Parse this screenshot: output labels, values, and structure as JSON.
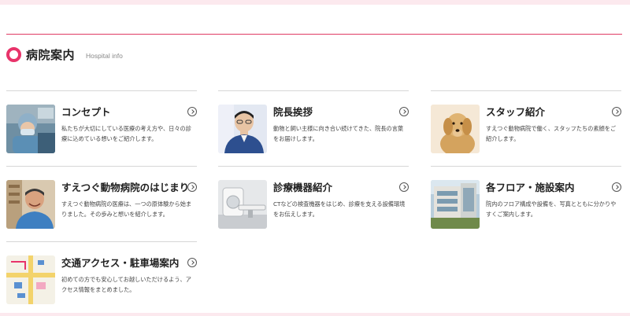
{
  "section": {
    "title": "病院案内",
    "subtitle": "Hospital info"
  },
  "cards": [
    {
      "title": "コンセプト",
      "desc": "私たちが大切にしている医療の考え方や、日々の診療に込めている想いをご紹介します。",
      "icon": "surgery-photo"
    },
    {
      "title": "院長挨拶",
      "desc": "動物と飼い主様に向き合い続けてきた、院長の言葉をお届けします。",
      "icon": "director-photo"
    },
    {
      "title": "スタッフ紹介",
      "desc": "すえつぐ動物病院で働く、スタッフたちの素顔をご紹介します。",
      "icon": "dog-photo"
    },
    {
      "title": "すえつぐ動物病院のはじまり",
      "desc": "すえつぐ動物病院の医療は、一つの原体験から始まりました。その歩みと想いを紹介します。",
      "icon": "founder-photo"
    },
    {
      "title": "診療機器紹介",
      "desc": "CTなどの検査機器をはじめ、診療を支える設備環境をお伝えします。",
      "icon": "ct-scanner-photo"
    },
    {
      "title": "各フロア・施設案内",
      "desc": "院内のフロア構成や設備を、写真とともに分かりやすくご案内します。",
      "icon": "building-photo"
    },
    {
      "title": "交通アクセス・駐車場案内",
      "desc": "初めての方でも安心してお越しいただけるよう、アクセス情報をまとめました。",
      "icon": "map-photo"
    }
  ]
}
